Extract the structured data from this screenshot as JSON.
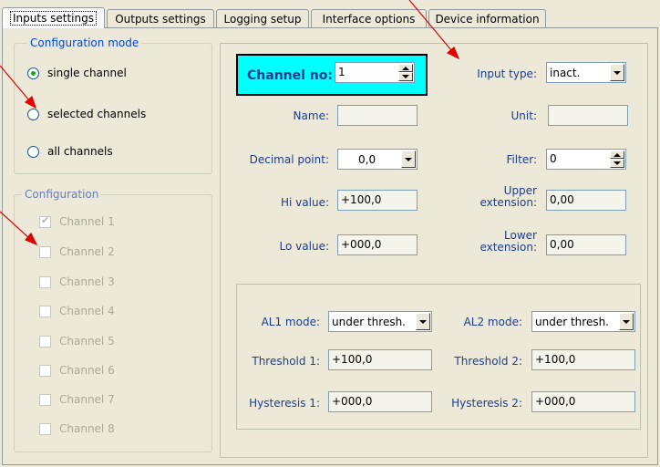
{
  "tabs": [
    {
      "label": "Inputs settings",
      "active": true
    },
    {
      "label": "Outputs settings",
      "active": false
    },
    {
      "label": "Logging setup",
      "active": false
    },
    {
      "label": "Interface options",
      "active": false
    },
    {
      "label": "Device information",
      "active": false
    }
  ],
  "config_mode": {
    "title": "Configuration mode",
    "options": [
      "single channel",
      "selected channels",
      "all channels"
    ],
    "selected": "single channel"
  },
  "configuration": {
    "title": "Configuration",
    "channels": [
      {
        "label": "Channel 1",
        "checked": true
      },
      {
        "label": "Channel 2",
        "checked": false
      },
      {
        "label": "Channel 3",
        "checked": false
      },
      {
        "label": "Channel 4",
        "checked": false
      },
      {
        "label": "Channel 5",
        "checked": false
      },
      {
        "label": "Channel 6",
        "checked": false
      },
      {
        "label": "Channel 7",
        "checked": false
      },
      {
        "label": "Channel 8",
        "checked": false
      }
    ]
  },
  "channel": {
    "label": "Channel no:",
    "value": "1"
  },
  "input_type": {
    "label": "Input type:",
    "value": "inact."
  },
  "name": {
    "label": "Name:",
    "value": ""
  },
  "unit": {
    "label": "Unit:",
    "value": ""
  },
  "decimal_point": {
    "label": "Decimal point:",
    "value": "0,0"
  },
  "filter": {
    "label": "Filter:",
    "value": "0"
  },
  "hi_value": {
    "label": "Hi value:",
    "value": "+100,0"
  },
  "upper_extension": {
    "label1": "Upper",
    "label2": "extension:",
    "value": "0,00"
  },
  "lo_value": {
    "label": "Lo value:",
    "value": "+000,0"
  },
  "lower_extension": {
    "label1": "Lower",
    "label2": "extension:",
    "value": "0,00"
  },
  "alarms": {
    "al1_mode": {
      "label": "AL1 mode:",
      "value": "under thresh."
    },
    "al2_mode": {
      "label": "AL2 mode:",
      "value": "under thresh."
    },
    "threshold1": {
      "label": "Threshold 1:",
      "value": "+100,0"
    },
    "threshold2": {
      "label": "Threshold 2:",
      "value": "+100,0"
    },
    "hysteresis1": {
      "label": "Hysteresis 1:",
      "value": "+000,0"
    },
    "hysteresis2": {
      "label": "Hysteresis 2:",
      "value": "+000,0"
    }
  },
  "colors": {
    "accent_blue": "#0046D5",
    "label_blue": "#1E3C8C",
    "channel_bg": "#00FFFF",
    "annotation_arrow": "#E00000"
  }
}
